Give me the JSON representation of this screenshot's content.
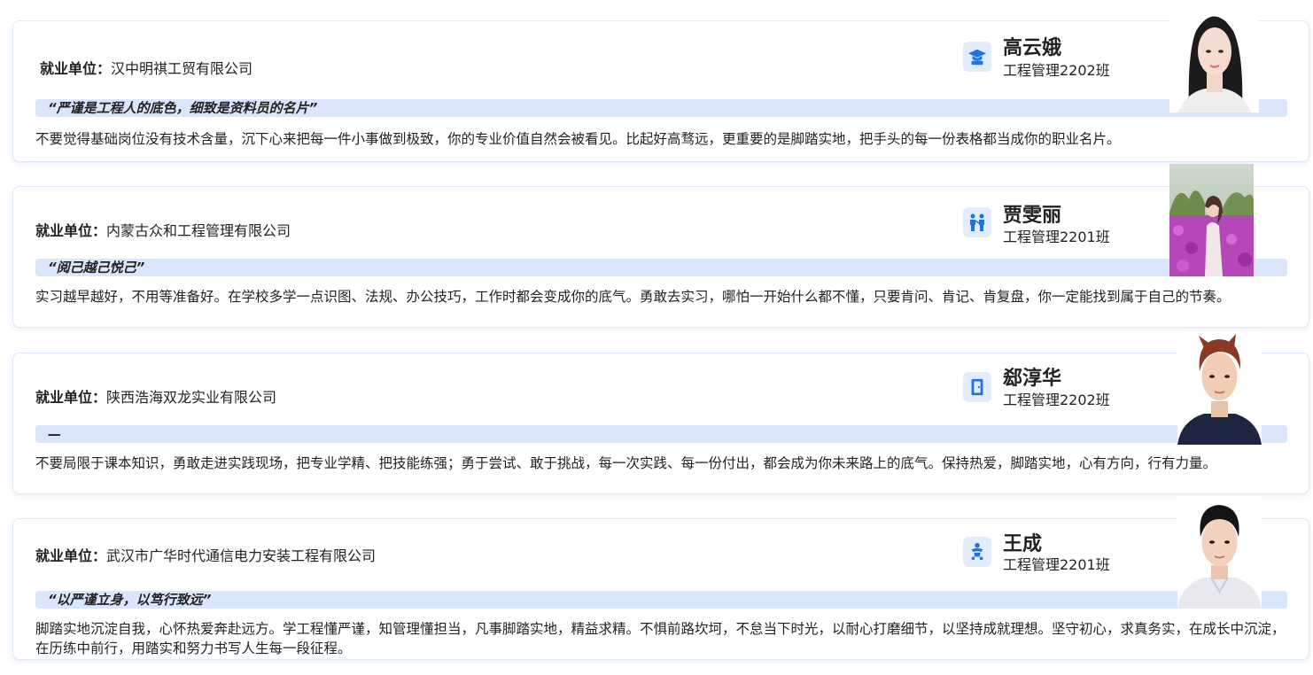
{
  "labels": {
    "company_label": "就业单位："
  },
  "colors": {
    "accent": "#1a73e8",
    "quote_bar": "#dae6fb",
    "icon_bg": "#e2ecfc",
    "card_border": "#dfe8f6"
  },
  "cards": [
    {
      "name": "高云娥",
      "class": "工程管理2202班",
      "company": "汉中明祺工贸有限公司",
      "quote": "“严谨是工程人的底色，细致是资料员的名片”",
      "body": "不要觉得基础岗位没有技术含量，沉下心来把每一件小事做到极致，你的专业价值自然会被看见。比起好高骛远，更重要的是脚踏实地，把手头的每一份表格都当成你的职业名片。",
      "icon": "graduate-icon"
    },
    {
      "name": "贾雯丽",
      "class": "工程管理2201班",
      "company": "内蒙古众和工程管理有限公司",
      "quote": "“阅己越己悦己”",
      "body": "实习越早越好，不用等准备好。在学校多学一点识图、法规、办公技巧，工作时都会变成你的底气。勇敢去实习，哪怕一开始什么都不懂，只要肯问、肯记、肯复盘，你一定能找到属于自己的节奏。",
      "icon": "people-icon"
    },
    {
      "name": "郄淳华",
      "class": "工程管理2202班",
      "company": "陕西浩海双龙实业有限公司",
      "quote": "—",
      "body": "不要局限于课本知识，勇敢走进实践现场，把专业学精、把技能练强；勇于尝试、敢于挑战，每一次实践、每一份付出，都会成为你未来路上的底气。保持热爱，脚踏实地，心有方向，行有力量。",
      "icon": "door-icon"
    },
    {
      "name": "王成",
      "class": "工程管理2201班",
      "company": "武汉市广华时代通信电力安装工程有限公司",
      "quote": "“以严谨立身，以笃行致远”",
      "body": "脚踏实地沉淀自我，心怀热爱奔赴远方。学工程懂严谨，知管理懂担当，凡事脚踏实地，精益求精。不惧前路坎坷，不怠当下时光，以耐心打磨细节，以坚持成就理想。坚守初心，求真务实，在成长中沉淀，在历练中前行，用踏实和努力书写人生每一段征程。",
      "icon": "baby-icon"
    }
  ]
}
